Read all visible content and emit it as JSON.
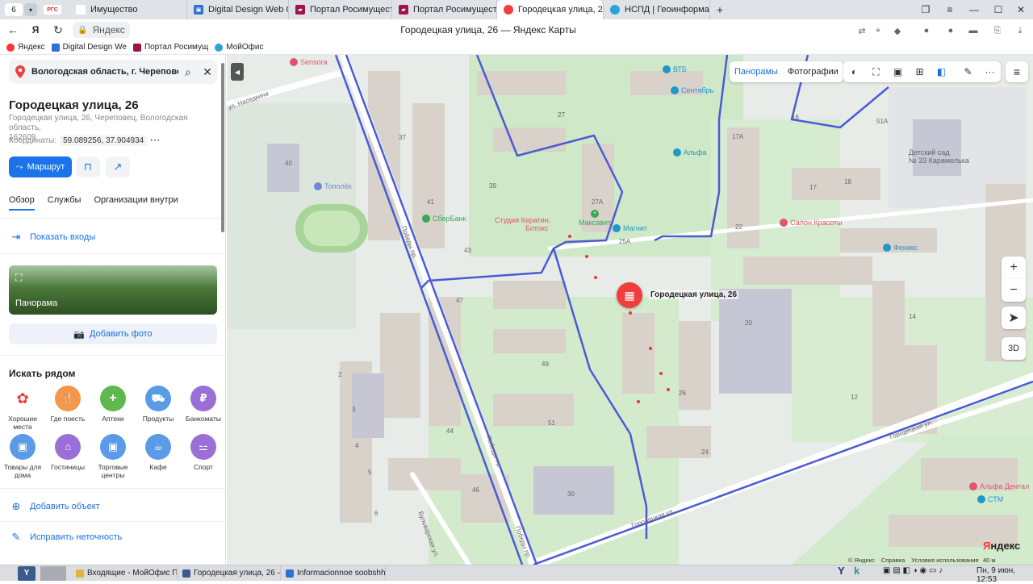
{
  "browser": {
    "tab_counter": "6",
    "tabs": [
      {
        "label": "РГС",
        "badge": "РГС",
        "color": "#d9232e"
      },
      {
        "label": "Имущество",
        "color": "#d9232e"
      },
      {
        "label": "Digital Design Web Client",
        "color": "#2f6fd6"
      },
      {
        "label": "Портал Росимущества",
        "color": "#a0134a"
      },
      {
        "label": "Портал Росимущества",
        "color": "#a0134a"
      },
      {
        "label": "Городецкая улица, 26",
        "color": "#f03d3d"
      },
      {
        "label": "НСПД | Геоинформацион",
        "color": "#2aa3d9"
      }
    ],
    "url": "Яндекс",
    "page_title": "Городецкая улица, 26 — Яндекс Карты",
    "bookmarks": [
      {
        "label": "Яндекс",
        "color": "#f33"
      },
      {
        "label": "Digital Design We",
        "color": "#2f6fd6"
      },
      {
        "label": "Портал Росимущ",
        "color": "#a0134a"
      },
      {
        "label": "МойОфис",
        "color": "#2aa3d9"
      }
    ]
  },
  "sidebar": {
    "search_value": "Вологодская область, г. Череповец,",
    "title": "Городецкая улица, 26",
    "address_line1": "Городецкая улица, 26, Череповец, Вологодская область,",
    "address_line2": "162609",
    "coords_label": "Координаты:",
    "coords_value": "59.089256, 37.904934",
    "route_label": "Маршрут",
    "tabs": [
      "Обзор",
      "Службы",
      "Организации внутри"
    ],
    "show_entrances": "Показать входы",
    "panorama_label": "Панорама",
    "add_photo": "Добавить фото",
    "nearby_title": "Искать рядом",
    "categories": [
      {
        "label": "Хорошие места",
        "color": "#ffffff",
        "icon": "good-places-icon"
      },
      {
        "label": "Где поесть",
        "color": "#f5964a",
        "icon": "fork-knife-icon"
      },
      {
        "label": "Аптеки",
        "color": "#5fb84d",
        "icon": "cross-icon"
      },
      {
        "label": "Продукты",
        "color": "#5a9ae6",
        "icon": "basket-icon"
      },
      {
        "label": "Банкоматы",
        "color": "#9b6fd8",
        "icon": "ruble-icon"
      },
      {
        "label": "Товары для дома",
        "color": "#5a9ae6",
        "icon": "bag-icon"
      },
      {
        "label": "Гостиницы",
        "color": "#9b6fd8",
        "icon": "bed-icon"
      },
      {
        "label": "Торговые центры",
        "color": "#5a9ae6",
        "icon": "bag-icon"
      },
      {
        "label": "Кафе",
        "color": "#5a9ae6",
        "icon": "cup-icon"
      },
      {
        "label": "Спорт",
        "color": "#9b6fd8",
        "icon": "dumbbell-icon"
      }
    ],
    "add_object": "Добавить объект",
    "fix_error": "Исправить неточность"
  },
  "map": {
    "toggle": [
      "Панорамы",
      "Фотографии"
    ],
    "marker_label": "Городецкая улица, 26",
    "zoom_in": "+",
    "zoom_out": "−",
    "mode_3d": "3D",
    "logo_y": "Я",
    "logo_rest": "ндекс",
    "scale": "40 м",
    "footer": [
      "© Яндекс",
      "Справка",
      "Условия использования"
    ],
    "pois": [
      {
        "name": "Sensora",
        "color": "#e0556a"
      },
      {
        "name": "ВТБ",
        "color": "#2196c9"
      },
      {
        "name": "Сентябрь",
        "color": "#2196c9"
      },
      {
        "name": "Альфа",
        "color": "#2196c9"
      },
      {
        "name": "Тополёк",
        "color": "#6f89d6"
      },
      {
        "name": "СберБанк",
        "color": "#3aa757"
      },
      {
        "name": "Студия Кератин,",
        "color": "#e0556a"
      },
      {
        "name": "Ботокс",
        "color": "#e0556a"
      },
      {
        "name": "Максавит",
        "color": "#3aa757"
      },
      {
        "name": "Магнит",
        "color": "#2196c9"
      },
      {
        "name": "Салон Красоты",
        "color": "#e0556a"
      },
      {
        "name": "Феникс",
        "color": "#2196c9"
      },
      {
        "name": "Детский сад",
        "color": "#888888"
      },
      {
        "name": "№ 33 Карамелька",
        "color": "#888888"
      },
      {
        "name": "Альфа Дентал",
        "color": "#e0556a"
      },
      {
        "name": "СТМ",
        "color": "#2196c9"
      }
    ],
    "streets": [
      "ул. Наседкина",
      "Победы пр.",
      "Победы пр.",
      "Городецкая ул.",
      "Городецкая ул.",
      "Бульварская ул.",
      "Победы пр."
    ],
    "house_numbers": [
      "37",
      "27",
      "17",
      "51А",
      "40",
      "41",
      "39",
      "27А",
      "25А",
      "18",
      "22",
      "43",
      "47",
      "20",
      "14",
      "49",
      "12",
      "2",
      "3",
      "51",
      "44",
      "4",
      "26",
      "24",
      "5",
      "6",
      "46",
      "30",
      "17А",
      "16"
    ]
  },
  "taskbar": {
    "items": [
      {
        "label": "Входящие - МойОфис По...",
        "color": "#e0b53a"
      },
      {
        "label": "Городецкая улица, 26 — ...",
        "color": "#3b5b8c"
      },
      {
        "label": "Informacionnoe soobshhe...",
        "color": "#2f6fd6"
      }
    ],
    "clock": "Пн, 9 июн, 12:53"
  }
}
